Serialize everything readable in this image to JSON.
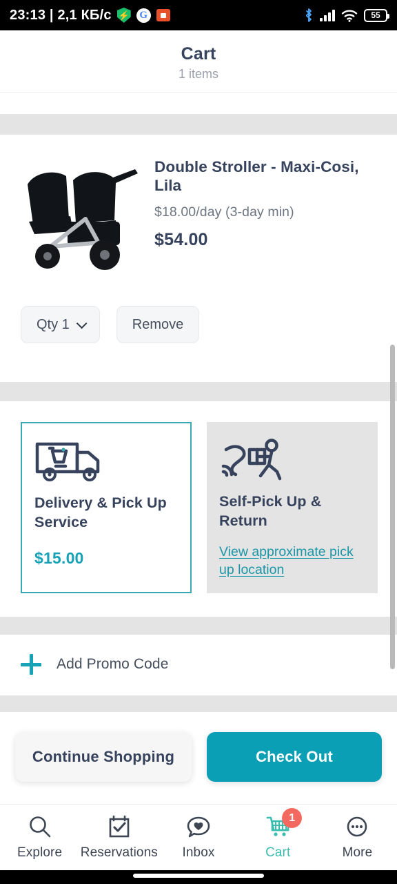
{
  "status_bar": {
    "clock": "23:13 | 2,1 КБ/с",
    "shield_icon": "shield-icon",
    "google_icon": "google-icon",
    "orange_icon": "media-icon",
    "bluetooth_icon": "bluetooth-icon",
    "signal_icon": "cellular-signal-icon",
    "wifi_icon": "wifi-icon",
    "battery_level": "55"
  },
  "header": {
    "title": "Cart",
    "subtitle": "1 items"
  },
  "cart_item": {
    "image_alt": "double-stroller-photo",
    "title": "Double Stroller - Maxi-Cosi, Lila",
    "rate": "$18.00/day (3-day min)",
    "price": "$54.00",
    "qty_label": "Qty 1",
    "remove_label": "Remove"
  },
  "fulfillment": {
    "delivery": {
      "icon": "delivery-truck-icon",
      "title": "Delivery & Pick Up Service",
      "price": "$15.00",
      "selected": true
    },
    "self_pickup": {
      "icon": "person-carrying-box-icon",
      "title": "Self-Pick Up & Return",
      "link": "View approximate pick up location",
      "selected": false
    }
  },
  "promo": {
    "icon": "plus-icon",
    "label": "Add Promo Code"
  },
  "buttons": {
    "continue": "Continue Shopping",
    "checkout": "Check Out"
  },
  "tabbar": {
    "items": [
      {
        "label": "Explore",
        "icon": "search-icon"
      },
      {
        "label": "Reservations",
        "icon": "calendar-check-icon"
      },
      {
        "label": "Inbox",
        "icon": "chat-heart-icon"
      },
      {
        "label": "Cart",
        "icon": "shopping-cart-icon",
        "badge": "1"
      },
      {
        "label": "More",
        "icon": "ellipsis-circle-icon"
      }
    ]
  },
  "colors": {
    "accent_teal": "#17a2b8",
    "checkout_teal": "#0a9fb5",
    "tab_active": "#3bbdb0",
    "badge_red": "#f4695f",
    "text_dark": "#37435c",
    "band_gray": "#e4e4e4"
  }
}
